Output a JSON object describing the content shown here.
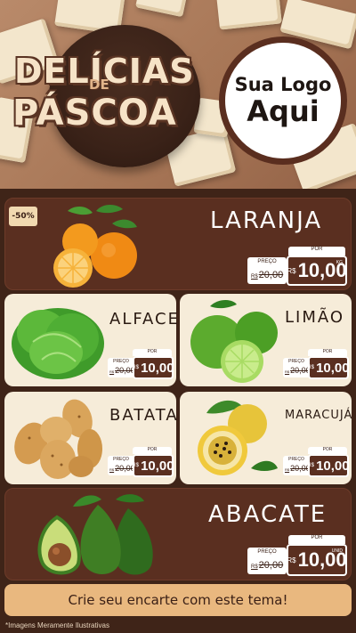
{
  "header": {
    "title_line1": "DELÍCIAS",
    "title_de": "DE",
    "title_line2": "PÁSCOA",
    "logo_line1": "Sua Logo",
    "logo_line2": "Aqui"
  },
  "discount_badge": "-50%",
  "products": [
    {
      "name": "LARANJA",
      "old_label": "PREÇO",
      "old_currency": "R$",
      "old_price": "20,00",
      "por_label": "POR",
      "new_currency": "R$",
      "new_price": "10,00",
      "unit": "KG"
    },
    {
      "name": "ALFACE",
      "old_label": "PREÇO",
      "old_currency": "R$",
      "old_price": "20,00",
      "por_label": "POR",
      "new_currency": "R$",
      "new_price": "10,00"
    },
    {
      "name": "LIMÃO",
      "old_label": "PREÇO",
      "old_currency": "R$",
      "old_price": "20,00",
      "por_label": "POR",
      "new_currency": "R$",
      "new_price": "10,00"
    },
    {
      "name": "BATATA",
      "old_label": "PREÇO",
      "old_currency": "R$",
      "old_price": "20,00",
      "por_label": "POR",
      "new_currency": "R$",
      "new_price": "10,00"
    },
    {
      "name": "MARACUJÁ",
      "old_label": "PREÇO",
      "old_currency": "R$",
      "old_price": "20,00",
      "por_label": "POR",
      "new_currency": "R$",
      "new_price": "10,00"
    },
    {
      "name": "ABACATE",
      "old_label": "PREÇO",
      "old_currency": "R$",
      "old_price": "20,00",
      "por_label": "POR",
      "new_currency": "R$",
      "new_price": "10,00",
      "unit": "UNID"
    }
  ],
  "cta": "Crie seu encarte com este tema!",
  "disclaimer": "*Imagens Meramente Ilustrativas",
  "colors": {
    "brown_dark": "#3f2418",
    "brown_card": "#5a2f20",
    "cream": "#f6ecd9",
    "cta": "#e9b87f"
  }
}
